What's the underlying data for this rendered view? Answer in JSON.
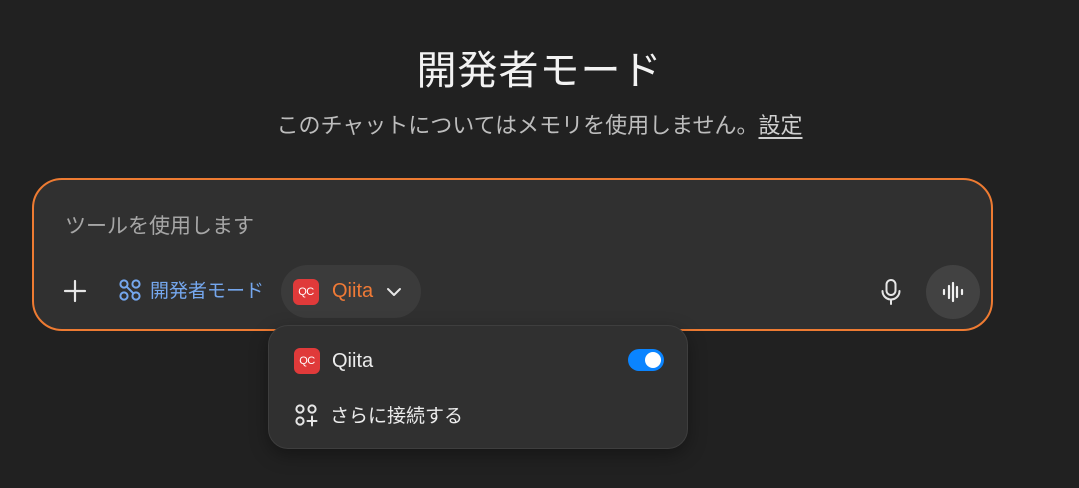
{
  "header": {
    "title": "開発者モード",
    "subtitle_text": "このチャットについてはメモリを使用しません。",
    "subtitle_link": "設定"
  },
  "composer": {
    "placeholder": "ツールを使用します",
    "plus_icon": "plus-icon",
    "dev_mode_label": "開発者モード",
    "connector_chip": {
      "logo_text": "QC",
      "label": "Qiita"
    },
    "mic_icon": "microphone-icon",
    "voice_icon": "voice-waveform-icon"
  },
  "dropdown": {
    "items": [
      {
        "logo_text": "QC",
        "label": "Qiita",
        "toggle_on": true
      },
      {
        "icon": "connect-apps-plus-icon",
        "label": "さらに接続する"
      }
    ]
  },
  "colors": {
    "background": "#212121",
    "composer_border": "#ee7b32",
    "accent_blue": "#75a7ee",
    "qiita_orange": "#f07a36",
    "qc_red": "#e03a3a",
    "toggle_blue": "#0a84ff"
  }
}
